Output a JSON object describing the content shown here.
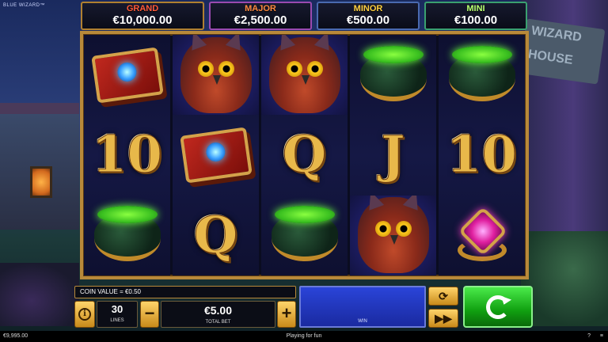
{
  "brand": "BLUE WIZARD™",
  "background": {
    "sign_text": "WIZARD HOUSE"
  },
  "jackpots": {
    "grand": {
      "title": "GRAND",
      "value": "€10,000.00"
    },
    "major": {
      "title": "MAJOR",
      "value": "€2,500.00"
    },
    "minor": {
      "title": "MINOR",
      "value": "€500.00"
    },
    "mini": {
      "title": "MINI",
      "value": "€100.00"
    }
  },
  "reels": [
    [
      "book",
      "10",
      "cauldron"
    ],
    [
      "owl",
      "book",
      "Q"
    ],
    [
      "owl",
      "Q",
      "cauldron"
    ],
    [
      "cauldron",
      "J",
      "owl"
    ],
    [
      "cauldron",
      "10",
      "ring"
    ]
  ],
  "controls": {
    "coin_value": "COIN VALUE = €0.50",
    "lines_value": "30",
    "lines_label": "LINES",
    "bet_minus": "−",
    "bet_plus": "+",
    "total_bet_value": "€5.00",
    "total_bet_label": "TOTAL BET",
    "win_label": "WIN",
    "auto_icon": "autoplay-icon",
    "turbo_icon": "fast-forward-icon",
    "spin_icon": "spin-icon"
  },
  "status": {
    "balance": "€9,995.00",
    "mode": "Playing for fun",
    "help": "?",
    "menu": "≡"
  },
  "colors": {
    "frame_gold": "#b8893a",
    "spin_green": "#10a010",
    "win_blue": "#2a44d8"
  }
}
